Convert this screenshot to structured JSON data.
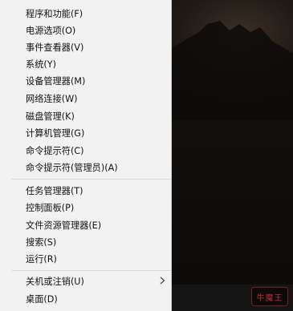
{
  "menu": {
    "group1": [
      {
        "label": "程序和功能(F)"
      },
      {
        "label": "电源选项(O)"
      },
      {
        "label": "事件查看器(V)"
      },
      {
        "label": "系统(Y)"
      },
      {
        "label": "设备管理器(M)"
      },
      {
        "label": "网络连接(W)"
      },
      {
        "label": "磁盘管理(K)"
      },
      {
        "label": "计算机管理(G)"
      },
      {
        "label": "命令提示符(C)"
      },
      {
        "label": "命令提示符(管理员)(A)"
      }
    ],
    "group2": [
      {
        "label": "任务管理器(T)"
      },
      {
        "label": "控制面板(P)"
      },
      {
        "label": "文件资源管理器(E)"
      },
      {
        "label": "搜索(S)"
      },
      {
        "label": "运行(R)"
      }
    ],
    "group3": [
      {
        "label": "关机或注销(U)",
        "submenu": true
      },
      {
        "label": "桌面(D)"
      }
    ]
  },
  "watermark": {
    "text": "牛魔王"
  },
  "colors": {
    "menu_bg": "#f2f2f2",
    "separator": "#d9d9d9",
    "watermark": "#c92a2a"
  },
  "icons": {
    "submenu_arrow": "chevron-right-icon"
  }
}
